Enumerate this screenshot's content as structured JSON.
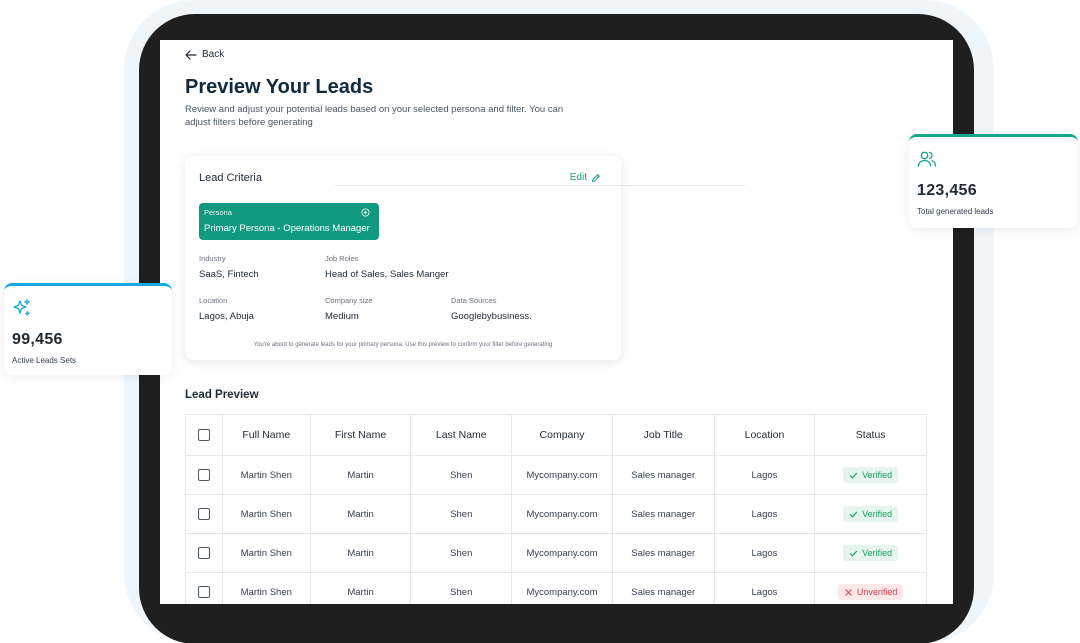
{
  "page": {
    "back_label": "Back",
    "title": "Preview Your Leads",
    "subtitle": "Review and adjust your potential leads based on your selected persona and filter. You can adjust filters before generating"
  },
  "criteria": {
    "title": "Lead Criteria",
    "edit_label": "Edit",
    "persona_label": "Persona",
    "persona_value": "Primary Persona - Operations Manager",
    "industry_label": "Industry",
    "industry_value": "SaaS, Fintech",
    "job_roles_label": "Job Roles",
    "job_roles_value": "Head of Sales, Sales Manger",
    "location_label": "Location",
    "location_value": "Lagos, Abuja",
    "company_size_label": "Company size",
    "company_size_value": "Medium",
    "data_sources_label": "Data Sources",
    "data_sources_value": "Googlebybusiness.",
    "note": "You're about to generate leads for your primary persona. Use this preview to confirm your filter before generating"
  },
  "preview": {
    "title": "Lead Preview",
    "columns": [
      "Full Name",
      "First Name",
      "Last Name",
      "Company",
      "Job Title",
      "Location",
      "Status"
    ],
    "rows": [
      {
        "full_name": "Martin Shen",
        "first_name": "Martin",
        "last_name": "Shen",
        "company": "Mycompany.com",
        "job_title": "Sales manager",
        "location": "Lagos",
        "status": "Verified"
      },
      {
        "full_name": "Martin Shen",
        "first_name": "Martin",
        "last_name": "Shen",
        "company": "Mycompany.com",
        "job_title": "Sales manager",
        "location": "Lagos",
        "status": "Verified"
      },
      {
        "full_name": "Martin Shen",
        "first_name": "Martin",
        "last_name": "Shen",
        "company": "Mycompany.com",
        "job_title": "Sales manager",
        "location": "Lagos",
        "status": "Verified"
      },
      {
        "full_name": "Martin Shen",
        "first_name": "Martin",
        "last_name": "Shen",
        "company": "Mycompany.com",
        "job_title": "Sales manager",
        "location": "Lagos",
        "status": "Unverified"
      }
    ]
  },
  "stats": {
    "left": {
      "value": "99,456",
      "label": "Active Leads Sets",
      "icon": "sparkle-icon"
    },
    "right": {
      "value": "123,456",
      "label": "Total generated leads",
      "icon": "users-icon"
    }
  },
  "colors": {
    "accent": "#129a80",
    "verified": "#17a05d",
    "unverified": "#e0404f",
    "left_stat_bar": "#19a8e0",
    "right_stat_bar": "#16a78b"
  }
}
